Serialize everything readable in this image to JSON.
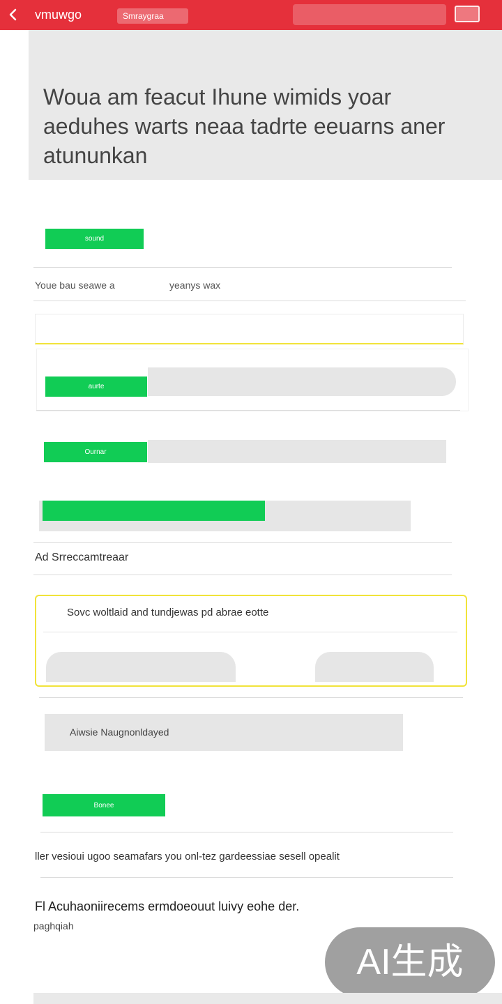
{
  "topbar": {
    "title": "vmuwgo",
    "tab_label": "Smraygraa",
    "back_icon": "chevron-left-icon"
  },
  "hero": {
    "text": "Woua am feacut Ihune wimids yoar aeduhes warts neaa tadrte eeuarns aner atununkan"
  },
  "section1": {
    "button_label": "sound"
  },
  "row1": {
    "left_label": "Youe bau seawe a",
    "right_label": "yeanys wax"
  },
  "input": {
    "value": "",
    "placeholder": ""
  },
  "section2": {
    "button_label": "aurte"
  },
  "section3": {
    "button_label": "Ournar"
  },
  "progress": {
    "fraction": 0.61
  },
  "row2": {
    "label": "Ad Srreccamtreaar"
  },
  "yellow_card": {
    "text": "Sovc woltlaid and tundjewas pd abrae eotte"
  },
  "gray_field": {
    "text": "Aiwsie Naugnonldayed"
  },
  "section4": {
    "button_label": "Bonee"
  },
  "row3": {
    "text": "ller vesioui ugoo seamafars you onl-tez gardeessiae sesell opealit"
  },
  "footer": {
    "line1": "Fl Acuhaoniirecems ermdoeouut luivy eohe der.",
    "line2": "paghqiah"
  },
  "badge": {
    "text": "AI生成"
  },
  "colors": {
    "topbar": "#e5303b",
    "accent_green": "#11cc55",
    "accent_yellow": "#f1e33a",
    "panel_gray": "#e9e9e9"
  }
}
